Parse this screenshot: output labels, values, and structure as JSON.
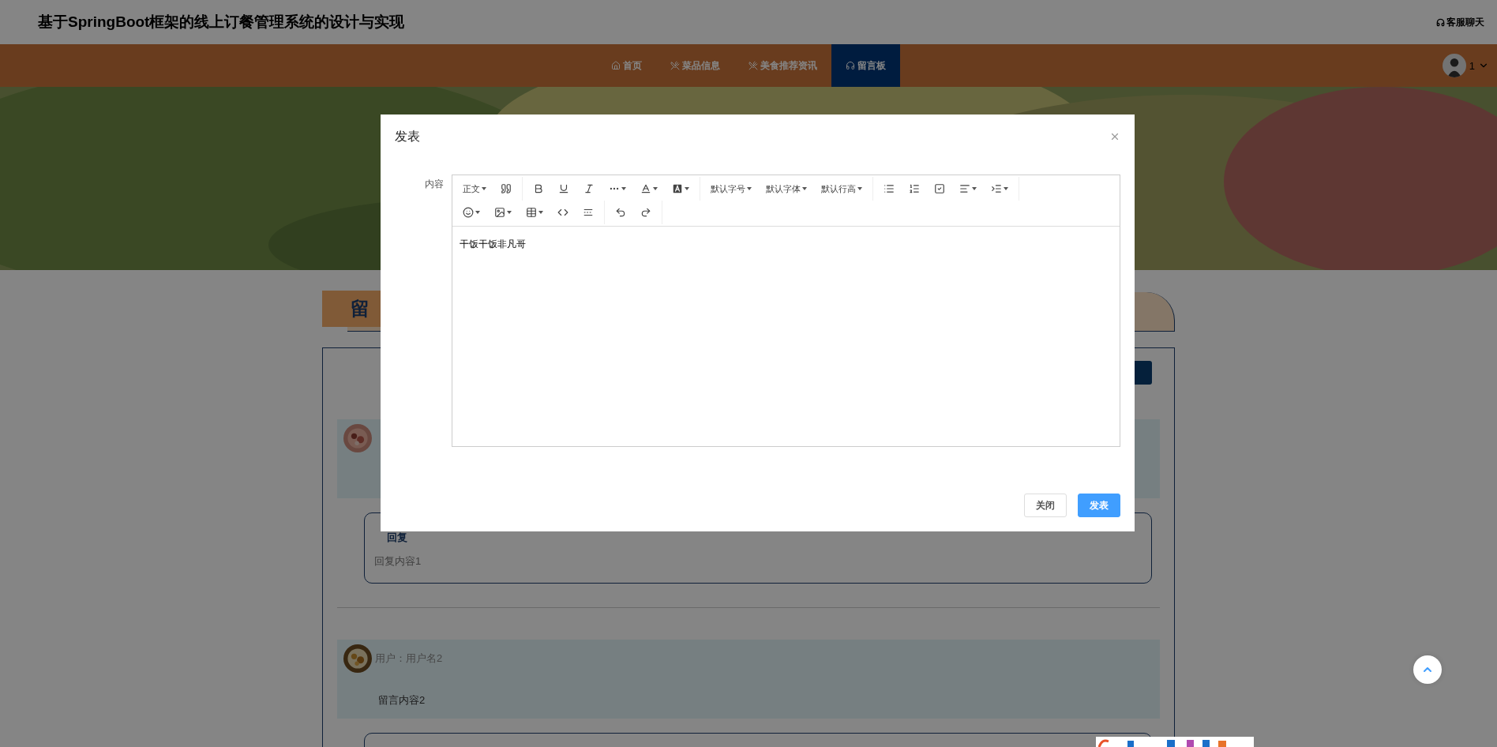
{
  "header": {
    "title": "基于SpringBoot框架的线上订餐管理系统的设计与实现",
    "chat_link": "客服聊天"
  },
  "nav": {
    "items": [
      {
        "label": "首页",
        "selected": false
      },
      {
        "label": "菜品信息",
        "selected": false
      },
      {
        "label": "美食推荐资讯",
        "selected": false
      },
      {
        "label": "留言板",
        "selected": true
      }
    ],
    "user": "1"
  },
  "section": {
    "title": "留"
  },
  "messages": [
    {
      "replies": [
        {
          "heading": "回复",
          "content": "回复内容1"
        }
      ]
    },
    {
      "user": "用户：用户名2",
      "content": "留言内容2",
      "replies": [
        {
          "kind": "reply"
        }
      ]
    }
  ],
  "dialog": {
    "title": "发表",
    "field_label": "内容",
    "toolbar": [
      [
        [
          {
            "kind": "dropdown",
            "label": "正文"
          },
          {
            "kind": "icon"
          }
        ],
        [
          {
            "kind": "icon"
          },
          {
            "kind": "icon"
          },
          {
            "kind": "icon"
          },
          {
            "kind": "menu"
          },
          {
            "kind": "menu"
          },
          {
            "kind": "menu"
          }
        ],
        [
          {
            "kind": "dropdown",
            "label": "默认字号"
          },
          {
            "kind": "dropdown",
            "label": "默认字体"
          },
          {
            "kind": "dropdown",
            "label": "默认行高"
          }
        ],
        [
          {
            "kind": "icon"
          },
          {
            "kind": "icon"
          },
          {
            "kind": "icon"
          },
          {
            "kind": "menu"
          },
          {
            "kind": "menu"
          }
        ]
      ],
      [
        [
          {
            "kind": "menu"
          },
          {
            "kind": "menu"
          },
          {
            "kind": "menu"
          },
          {
            "kind": "icon"
          },
          {
            "kind": "icon"
          }
        ],
        [
          {
            "kind": "icon"
          },
          {
            "kind": "icon"
          }
        ]
      ]
    ],
    "content": "干饭干饭非凡哥",
    "buttons": [
      {
        "label": "关闭",
        "primary": false
      },
      {
        "label": "发表",
        "primary": true
      }
    ]
  }
}
